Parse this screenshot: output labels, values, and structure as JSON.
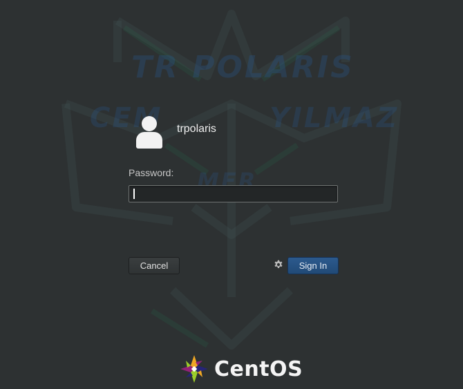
{
  "watermark": {
    "title": "TR POLARIS",
    "left": "CEM",
    "right": "YILMAZ",
    "middle": "MER"
  },
  "user": {
    "name": "trpolaris",
    "avatar_icon": "user-avatar-icon"
  },
  "password": {
    "label": "Password:",
    "value": "",
    "placeholder": ""
  },
  "buttons": {
    "cancel": "Cancel",
    "sign_in": "Sign In",
    "settings_icon": "gear-icon"
  },
  "footer": {
    "brand": "CentOS",
    "logo_icon": "centos-logo-icon"
  },
  "colors": {
    "background": "#2d3132",
    "accent": "#2c5a8e"
  }
}
